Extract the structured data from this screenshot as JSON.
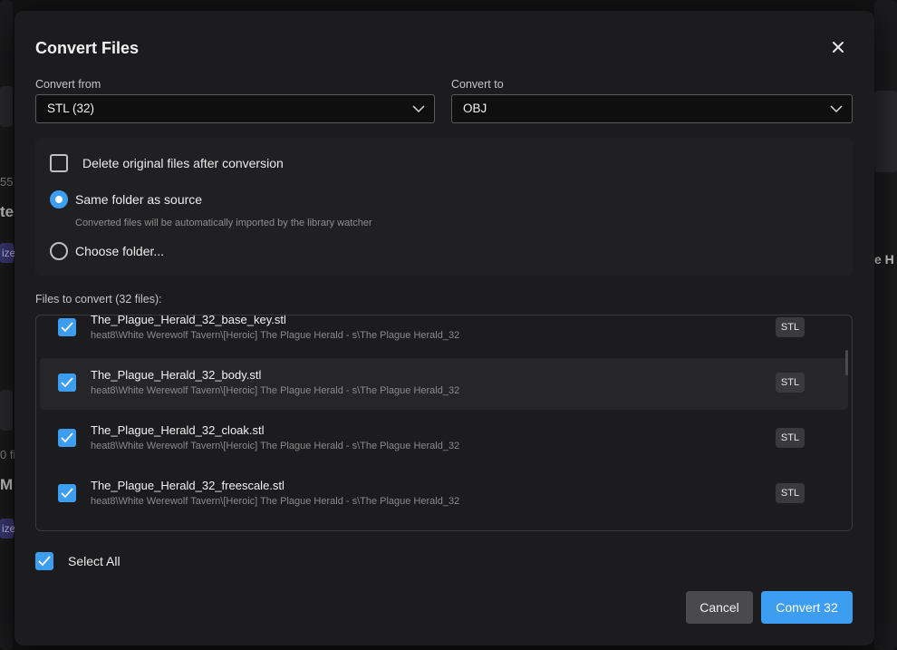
{
  "background": {
    "fragments": [
      "55 f",
      "te",
      "ize",
      "e H",
      "0 fil",
      "M",
      "ize"
    ]
  },
  "dialog": {
    "title": "Convert Files",
    "close_icon": "close-icon"
  },
  "convert_from": {
    "label": "Convert from",
    "value": "STL (32)"
  },
  "convert_to": {
    "label": "Convert to",
    "value": "OBJ"
  },
  "options": {
    "delete_original": {
      "label": "Delete original files after conversion",
      "checked": false
    },
    "same_folder": {
      "label": "Same folder as source",
      "selected": true,
      "hint": "Converted files will be automatically imported by the library watcher"
    },
    "choose_folder": {
      "label": "Choose folder...",
      "selected": false
    }
  },
  "files": {
    "label": "Files to convert (32 files):",
    "items": [
      {
        "name": "The_Plague_Herald_32_base_key.stl",
        "path": "heat8\\White Werewolf Tavern\\[Heroic] The Plague Herald - s\\The Plague Herald_32",
        "badge": "STL",
        "checked": true
      },
      {
        "name": "The_Plague_Herald_32_body.stl",
        "path": "heat8\\White Werewolf Tavern\\[Heroic] The Plague Herald - s\\The Plague Herald_32",
        "badge": "STL",
        "checked": true
      },
      {
        "name": "The_Plague_Herald_32_cloak.stl",
        "path": "heat8\\White Werewolf Tavern\\[Heroic] The Plague Herald - s\\The Plague Herald_32",
        "badge": "STL",
        "checked": true
      },
      {
        "name": "The_Plague_Herald_32_freescale.stl",
        "path": "heat8\\White Werewolf Tavern\\[Heroic] The Plague Herald - s\\The Plague Herald_32",
        "badge": "STL",
        "checked": true
      }
    ]
  },
  "select_all": {
    "label": "Select All",
    "checked": true
  },
  "buttons": {
    "cancel": "Cancel",
    "convert": "Convert 32"
  },
  "colors": {
    "accent": "#3d9df0",
    "modal_bg": "#1c1c1e",
    "panel_bg": "#202022"
  }
}
